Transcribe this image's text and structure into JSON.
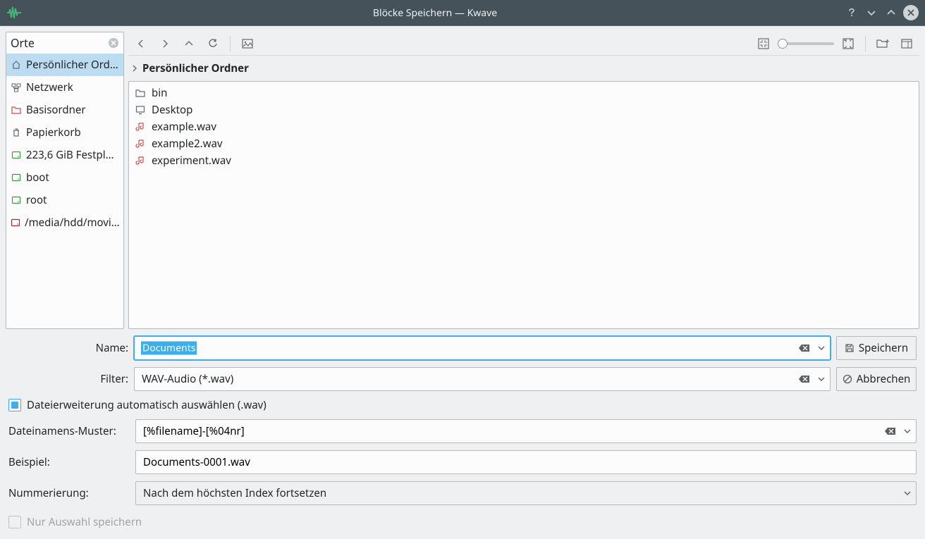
{
  "titlebar": {
    "title": "Blöcke Speichern — Kwave"
  },
  "places": {
    "header": "Orte",
    "items": [
      {
        "name": "Persönlicher Ord…",
        "icon": "home-icon",
        "selected": true
      },
      {
        "name": "Netzwerk",
        "icon": "network-icon"
      },
      {
        "name": "Basisordner",
        "icon": "folder-icon"
      },
      {
        "name": "Papierkorb",
        "icon": "trash-icon"
      },
      {
        "name": "223,6 GiB Festpl…",
        "icon": "drive-icon"
      },
      {
        "name": "boot",
        "icon": "drive-icon"
      },
      {
        "name": "root",
        "icon": "drive-icon"
      },
      {
        "name": "/media/hdd/movi…",
        "icon": "drive-icon"
      }
    ]
  },
  "breadcrumb": {
    "current": "Persönlicher Ordner"
  },
  "files": [
    {
      "name": "bin",
      "icon": "folder-outline-icon",
      "type": "dir"
    },
    {
      "name": "Desktop",
      "icon": "desktop-icon",
      "type": "dir"
    },
    {
      "name": "example.wav",
      "icon": "audio-icon",
      "type": "audio"
    },
    {
      "name": "example2.wav",
      "icon": "audio-icon",
      "type": "audio"
    },
    {
      "name": "experiment.wav",
      "icon": "audio-icon",
      "type": "audio"
    }
  ],
  "form": {
    "name_label": "Name:",
    "name_value": "Documents",
    "filter_label": "Filter:",
    "filter_value": "WAV-Audio (*.wav)",
    "save_button": "Speichern",
    "cancel_button": "Abbrechen",
    "auto_ext_label": "Dateierweiterung automatisch auswählen (.wav)",
    "pattern_label": "Dateinamens-Muster:",
    "pattern_value": "[%filename]-[%04nr]",
    "example_label": "Beispiel:",
    "example_value": "Documents-0001.wav",
    "numbering_label": "Nummerierung:",
    "numbering_value": "Nach dem höchsten Index fortsetzen",
    "only_selection_label": "Nur Auswahl speichern"
  }
}
